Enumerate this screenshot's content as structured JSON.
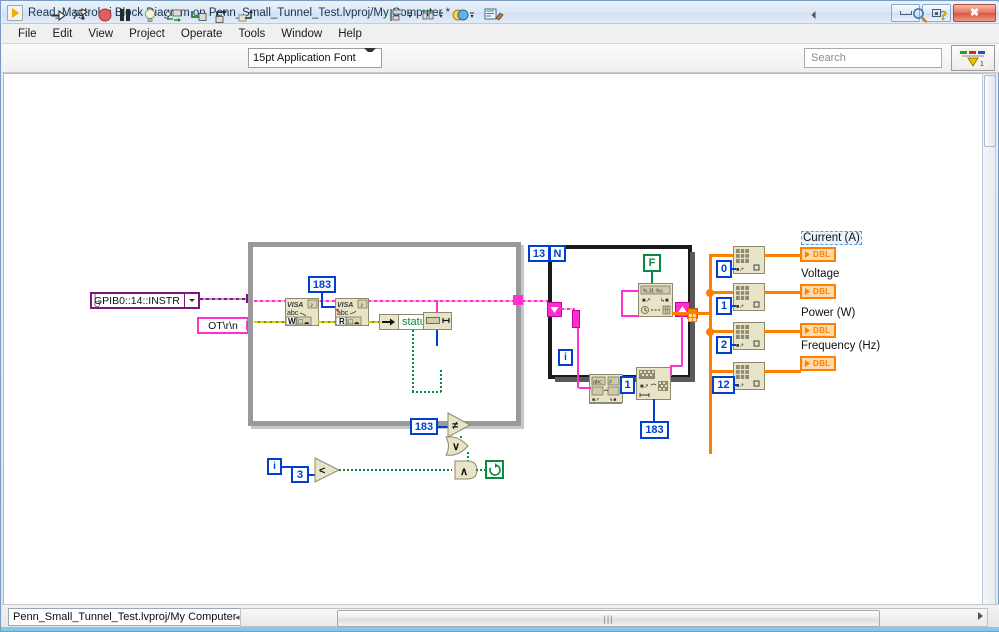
{
  "window": {
    "title": "Read_Magtrol.vi Block Diagram on Penn_Small_Tunnel_Test.lvproj/My Computer *",
    "app_icon": "labview-run-arrow-icon",
    "buttons": {
      "minimize": "minimize",
      "maximize": "maximize",
      "close": "close"
    }
  },
  "menubar": {
    "items": [
      {
        "label": "File"
      },
      {
        "label": "Edit"
      },
      {
        "label": "View"
      },
      {
        "label": "Project"
      },
      {
        "label": "Operate"
      },
      {
        "label": "Tools"
      },
      {
        "label": "Window"
      },
      {
        "label": "Help"
      }
    ]
  },
  "toolbar": {
    "font_selector": {
      "value": "15pt Application Font"
    },
    "search": {
      "placeholder": "Search"
    },
    "icons": [
      "run-arrow-icon",
      "run-continuously-icon",
      "abort-execution-icon",
      "pause-icon",
      "highlight-execution-icon",
      "retain-wire-values-icon",
      "step-into-icon",
      "step-over-icon",
      "step-out-icon",
      "align-objects-icon",
      "distribute-objects-icon",
      "reorder-icon",
      "clean-up-diagram-icon",
      "search-icon",
      "help-icon",
      "labview-logo-icon"
    ]
  },
  "statusbar": {
    "path": "Penn_Small_Tunnel_Test.lvproj/My Computer",
    "collapse_arrow": "◂"
  },
  "diagram": {
    "controls": {
      "visa_resource": {
        "label": "GPIB0::14::INSTR",
        "prefix": "I/O",
        "dropdown": "chevron-down-icon"
      },
      "command_string": {
        "value": "OT\\r\\n"
      }
    },
    "while_loop": {
      "name": "while-loop",
      "iteration_label": "i",
      "visa_write": {
        "title": "VISA",
        "sub": "abc",
        "terminal": "W"
      },
      "visa_read": {
        "title": "VISA",
        "sub": "abc",
        "terminal": "R"
      },
      "byte_count": "183",
      "status_indicator": {
        "label": "status"
      },
      "compare_constant": "183",
      "loop_count_constant": "3",
      "less_than": "<",
      "not_equal": "≠",
      "or_gate": "∨",
      "and_gate": "∧",
      "stop_terminal": "loop-condition"
    },
    "for_loop": {
      "name": "for-loop",
      "count_constant": "13",
      "count_terminal": "N",
      "iteration_label": "i",
      "false_constant": "F",
      "offset_constant": "1",
      "length_constant": "183",
      "string_subset_fn": "string-subset",
      "spreadsheet_to_array_fn": "spreadsheet-string-to-array",
      "search_split_fn": "search-split-string",
      "build_array_fn": "build-array"
    },
    "outputs": [
      {
        "index": "0",
        "label": "Current (A)",
        "type": "DBL",
        "selected": true
      },
      {
        "index": "1",
        "label": "Voltage",
        "type": "DBL",
        "selected": false
      },
      {
        "index": "2",
        "label": "Power (W)",
        "type": "DBL",
        "selected": false
      },
      {
        "index": "12",
        "label": "Frequency (Hz)",
        "type": "DBL",
        "selected": false
      }
    ]
  },
  "colors": {
    "visa_wire": "#ff2fd0",
    "error_wire": "#cfcf00",
    "boolean_wire": "#0a8a3c",
    "numeric_wire": "#0040d0",
    "array_wire": "#ff8000",
    "io_control": "#7b187b",
    "node_fill": "#e8e4c8",
    "indicator_fill": "#ffd9a8"
  }
}
